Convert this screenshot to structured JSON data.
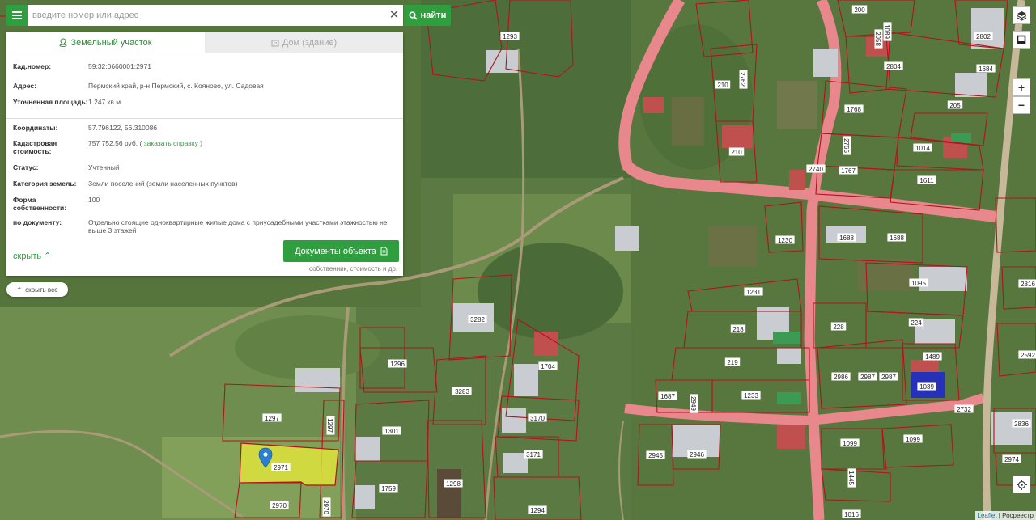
{
  "search": {
    "placeholder": "введите номер или адрес",
    "find_label": "найти"
  },
  "tabs": [
    {
      "label": "Земельный участок",
      "icon": "parcel-pin-icon"
    },
    {
      "label": "Дом (здание)",
      "icon": "building-icon"
    }
  ],
  "details": {
    "cad_number_label": "Кад.номер:",
    "cad_number": "59:32:0660001:2971",
    "address_label": "Адрес:",
    "address": "Пермский край, р-н Пермский, с. Кояново, ул. Садовая",
    "area_label": "Уточненная площадь:",
    "area": "1 247 кв.м",
    "coords_label": "Координаты:",
    "coords": "57.796122, 56.310086",
    "cost_label": "Кадастровая стоимость:",
    "cost": "757 752.56 руб.",
    "cost_paren_open": "(",
    "cost_link": "заказать справку",
    "cost_paren_close": ")",
    "status_label": "Статус:",
    "status": "Учтенный",
    "category_label": "Категория земель:",
    "category": "Земли поселений (земли населенных пунктов)",
    "ownership_label": "Форма собственности:",
    "ownership": "100",
    "by_doc_label": "по документу:",
    "by_doc": "Отдельно стоящие одноквартирные жилые дома с приусадебными участками этажностью не выше 3 этажей"
  },
  "actions": {
    "hide_label": "скрыть",
    "docs_button": "Документы объекта",
    "docs_sub": "собственник, стоимость и др.",
    "hide_all": "скрыть все"
  },
  "map_controls": {
    "zoom_in": "+",
    "zoom_out": "−"
  },
  "attribution": {
    "leaflet": "Leaflet",
    "separator": "|",
    "rosreestr": "Росреестр"
  },
  "plots": [
    "1293",
    "200",
    "2802",
    "1684",
    "210",
    "2762",
    "1768",
    "2803",
    "205",
    "1014",
    "210",
    "2765",
    "1767",
    "1611",
    "1230",
    "1688",
    "1688",
    "1095",
    "1231",
    "218",
    "228",
    "224",
    "1489",
    "219",
    "2986",
    "2987",
    "2987",
    "1039",
    "1687",
    "2949",
    "1233",
    "1296",
    "3282",
    "3283",
    "1704",
    "3170",
    "3171",
    "1297",
    "1297",
    "2971",
    "2970",
    "2970",
    "1301",
    "1759",
    "1298",
    "1294",
    "2945",
    "2946",
    "1099",
    "1099",
    "1445",
    "1016",
    "2732",
    "2836",
    "2974",
    "2816",
    "2592",
    "2058",
    "2804",
    "3283",
    "1089",
    "2740"
  ],
  "colors": {
    "accent": "#2e9e3e",
    "road": "#e8878c",
    "parcel_border": "#b0141c",
    "selected_parcel": "#e4e83a",
    "marker": "#2a7fd1"
  }
}
